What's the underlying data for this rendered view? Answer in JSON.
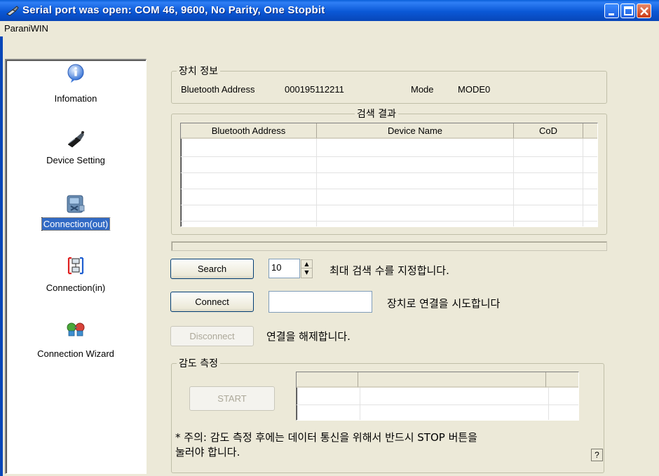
{
  "window": {
    "title": "Serial port was open: COM 46, 9600, No Parity, One Stopbit"
  },
  "menu": {
    "items": [
      "ParaniWIN"
    ]
  },
  "sidebar": {
    "items": [
      {
        "label": "Infomation",
        "icon": "info-icon",
        "selected": false
      },
      {
        "label": "Device Setting",
        "icon": "device-setting-icon",
        "selected": false
      },
      {
        "label": "Connection(out)",
        "icon": "connection-out-icon",
        "selected": true
      },
      {
        "label": "Connection(in)",
        "icon": "connection-in-icon",
        "selected": false
      },
      {
        "label": "Connection Wizard",
        "icon": "connection-wizard-icon",
        "selected": false
      }
    ]
  },
  "device_info": {
    "title": "장치 정보",
    "address_label": "Bluetooth Address",
    "address_value": "000195112211",
    "mode_label": "Mode",
    "mode_value": "MODE0"
  },
  "search_results": {
    "title": "검색 결과",
    "columns": [
      "Bluetooth Address",
      "Device Name",
      "CoD"
    ],
    "rows": []
  },
  "search": {
    "button_label": "Search",
    "count_value": "10",
    "hint": "최대 검색 수를 지정합니다."
  },
  "connect": {
    "button_label": "Connect",
    "address_value": "",
    "hint": "장치로 연결을 시도합니다"
  },
  "disconnect": {
    "button_label": "Disconnect",
    "hint": "연결을 해제합니다."
  },
  "sensitivity": {
    "title": "감도 측정",
    "start_label": "START",
    "note_line1": "* 주의: 감도 측정 후에는 데이터 통신을 위해서 반드시 STOP 버튼을",
    "note_line2": "눌러야 합니다.",
    "help_label": "?"
  },
  "colors": {
    "titlebar": "#0a58d6",
    "selection": "#316ac5",
    "window_bg": "#ece9d8"
  }
}
